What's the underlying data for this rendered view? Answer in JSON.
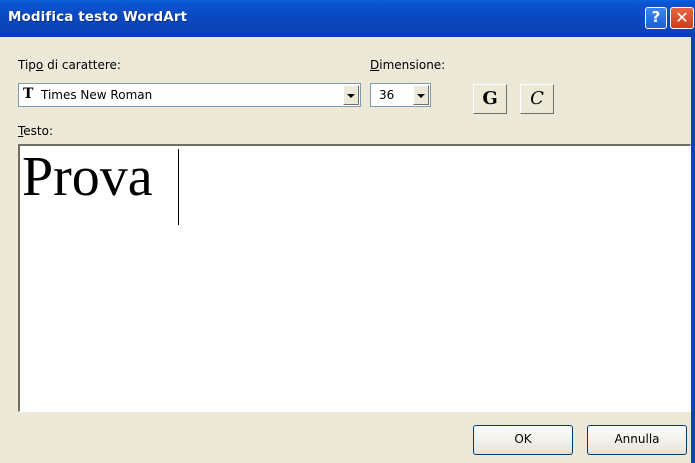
{
  "window": {
    "title": "Modifica testo WordArt",
    "help_glyph": "?",
    "close_glyph": "✕"
  },
  "font": {
    "label_pre": "Tip",
    "label_accel": "o",
    "label_post": " di carattere:",
    "selected": "Times New Roman",
    "icon_glyph": "T"
  },
  "size": {
    "label_accel": "D",
    "label_post": "imensione:",
    "selected": "36"
  },
  "format": {
    "bold_label": "G",
    "italic_label": "C"
  },
  "text": {
    "label_accel": "T",
    "label_post": "esto:",
    "value": "Prova"
  },
  "buttons": {
    "ok": "OK",
    "cancel": "Annulla"
  },
  "colors": {
    "titlebar": "#0a4ac4",
    "dialog_bg": "#ece9d8",
    "close": "#c8401a"
  }
}
